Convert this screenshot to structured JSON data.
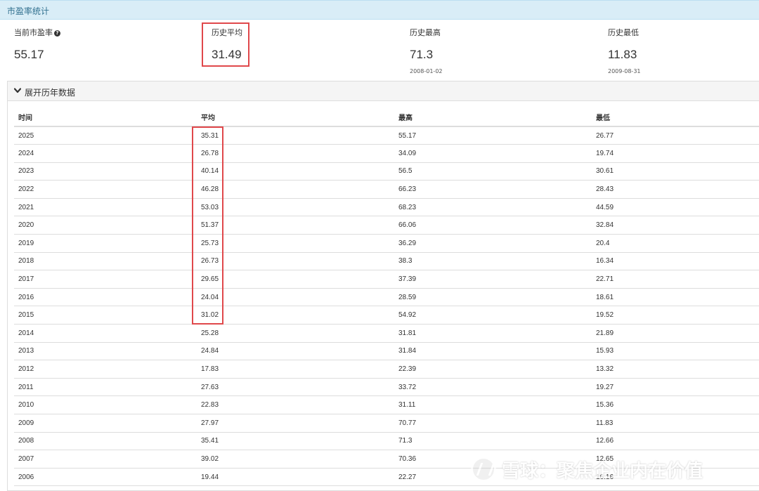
{
  "header": {
    "title": "市盈率统计"
  },
  "stats": {
    "current": {
      "label": "当前市盈率",
      "value": "55.17"
    },
    "average": {
      "label": "历史平均",
      "value": "31.49"
    },
    "high": {
      "label": "历史最高",
      "value": "71.3",
      "date": "2008-01-02"
    },
    "low": {
      "label": "历史最低",
      "value": "11.83",
      "date": "2009-08-31"
    }
  },
  "panel": {
    "title": "展开历年数据",
    "toggle_icon": "chevron-down-icon"
  },
  "table": {
    "headers": [
      "时间",
      "平均",
      "最高",
      "最低"
    ],
    "rows": [
      [
        "2025",
        "35.31",
        "55.17",
        "26.77"
      ],
      [
        "2024",
        "26.78",
        "34.09",
        "19.74"
      ],
      [
        "2023",
        "40.14",
        "56.5",
        "30.61"
      ],
      [
        "2022",
        "46.28",
        "66.23",
        "28.43"
      ],
      [
        "2021",
        "53.03",
        "68.23",
        "44.59"
      ],
      [
        "2020",
        "51.37",
        "66.06",
        "32.84"
      ],
      [
        "2019",
        "25.73",
        "36.29",
        "20.4"
      ],
      [
        "2018",
        "26.73",
        "38.3",
        "16.34"
      ],
      [
        "2017",
        "29.65",
        "37.39",
        "22.71"
      ],
      [
        "2016",
        "24.04",
        "28.59",
        "18.61"
      ],
      [
        "2015",
        "31.02",
        "54.92",
        "19.52"
      ],
      [
        "2014",
        "25.28",
        "31.81",
        "21.89"
      ],
      [
        "2013",
        "24.84",
        "31.84",
        "15.93"
      ],
      [
        "2012",
        "17.83",
        "22.39",
        "13.32"
      ],
      [
        "2011",
        "27.63",
        "33.72",
        "19.27"
      ],
      [
        "2010",
        "22.83",
        "31.11",
        "15.36"
      ],
      [
        "2009",
        "27.97",
        "70.77",
        "11.83"
      ],
      [
        "2008",
        "35.41",
        "71.3",
        "12.66"
      ],
      [
        "2007",
        "39.02",
        "70.36",
        "12.65"
      ],
      [
        "2006",
        "19.44",
        "22.27",
        "16.16"
      ]
    ]
  },
  "watermark": {
    "text": "雪球：聚焦企业内在价值"
  },
  "colors": {
    "highlight": "#e0484b",
    "header_bg": "#d9edf7",
    "header_text": "#31708f"
  }
}
